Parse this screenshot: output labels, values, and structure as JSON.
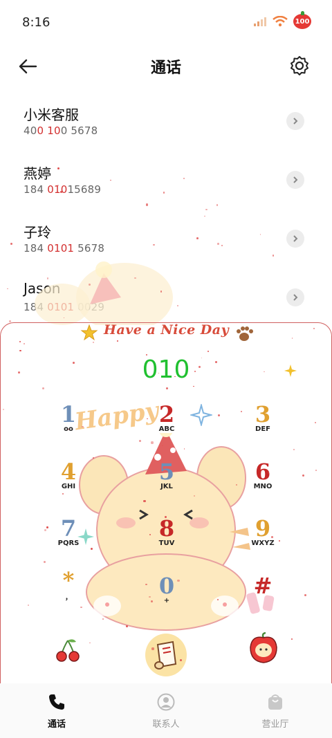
{
  "status": {
    "time": "8:16",
    "battery": "100"
  },
  "header": {
    "title": "通话"
  },
  "contacts": [
    {
      "name": "小米客服",
      "num_pre": "40",
      "num_hl": "0 10",
      "num_post": "0 5678"
    },
    {
      "name": "燕婷",
      "num_pre": "184 ",
      "num_hl": "010",
      "num_post": "15689"
    },
    {
      "name": "子玲",
      "num_pre": "184 ",
      "num_hl": "0101",
      "num_post": " 5678"
    },
    {
      "name": "Jason",
      "num_pre": "184 ",
      "num_hl": "0101",
      "num_post": " 0029"
    }
  ],
  "dialer": {
    "banner": "Have a Nice Day",
    "deco_text": "Happy",
    "number": "010",
    "keys": [
      {
        "digit": "1",
        "letters": "ᴏᴏ",
        "color": "#6e8fb8"
      },
      {
        "digit": "2",
        "letters": "ABC",
        "color": "#c62828"
      },
      {
        "digit": "3",
        "letters": "DEF",
        "color": "#e0a030"
      },
      {
        "digit": "4",
        "letters": "GHI",
        "color": "#e0a030"
      },
      {
        "digit": "5",
        "letters": "JKL",
        "color": "#6e8fb8"
      },
      {
        "digit": "6",
        "letters": "MNO",
        "color": "#c62828"
      },
      {
        "digit": "7",
        "letters": "PQRS",
        "color": "#6e8fb8"
      },
      {
        "digit": "8",
        "letters": "TUV",
        "color": "#c62828"
      },
      {
        "digit": "9",
        "letters": "WXYZ",
        "color": "#e0a030"
      },
      {
        "digit": "*",
        "letters": "，",
        "color": "#e0a030"
      },
      {
        "digit": "0",
        "letters": "+",
        "color": "#6e8fb8"
      },
      {
        "digit": "#",
        "letters": "",
        "color": "#c62828"
      }
    ]
  },
  "tabs": [
    {
      "label": "通话",
      "icon": "phone-icon",
      "active": true
    },
    {
      "label": "联系人",
      "icon": "contacts-icon",
      "active": false
    },
    {
      "label": "营业厅",
      "icon": "bag-icon",
      "active": false
    }
  ],
  "colors": {
    "accent_red": "#d32f2f",
    "dial_green": "#20c030"
  }
}
